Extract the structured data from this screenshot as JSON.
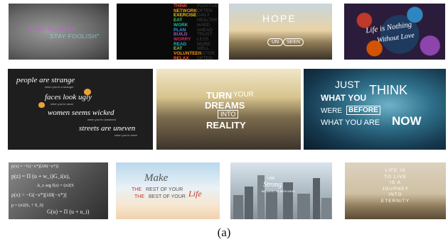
{
  "caption": "(a)",
  "tiles": {
    "t1": {
      "line1": "\"STAY HUNGRY",
      "line2": "STAY FOOLISH\""
    },
    "t2": {
      "left_words": [
        "THINK",
        "NETWORK",
        "EXERCISE",
        "EAT",
        "WORK",
        "PLAN",
        "BUILD",
        "WORRY",
        "READ",
        "EAT",
        "VOLUNTEER",
        "RELAX",
        "LOVE",
        "LIVE"
      ],
      "right_words": [
        "POSITIVELY",
        "OFTEN",
        "DAILY",
        "HEALTHY",
        "HARD",
        "AHEAD",
        "TRUST",
        "LESS",
        "MORE",
        "WELL",
        "FASTER",
        "OFTEN",
        "ALWAYS",
        "NOW"
      ]
    },
    "t3": {
      "line1": "HOPE",
      "line2": "UN",
      "line3": "SEEN"
    },
    "t4": {
      "line1": "Life is Nothing",
      "line2": "Without Love"
    },
    "t5": {
      "l1": "people are strange",
      "s1": "when you're a stranger",
      "l2": "faces look ugly",
      "s2": "when you're alone",
      "l3": "women seems wicked",
      "s3": "when you're unwanted",
      "l4": "streets are uneven",
      "s4": "when you're down"
    },
    "t6": {
      "w1": "TURN",
      "w2": "YOUR",
      "w3": "DREAMS",
      "w4": "INTO",
      "w5": "REALITY"
    },
    "t7": {
      "w1": "JUST",
      "w2": "WHAT YOU",
      "w3": "THINK",
      "w4": "WERE",
      "w5": "BEFORE",
      "w6": "WHAT YOU ARE",
      "w7": "NOW"
    },
    "t8": {
      "eq1": "p(x) = −G(−x*)[λH(−x*)]",
      "eq2": "p(z) = Π (u + w_i)G_i(u),",
      "eq3": "Δ_z arg f(z) = (σ2(S",
      "eq4": "p(x) = −G(−x*)[λH(−x*)]",
      "eq5": "p = (σ2(S, + S_0)",
      "eq6": "G(u) = Π (u + u_i)"
    },
    "t9": {
      "w1": "Make",
      "w2": "THE",
      "w3": "REST OF YOUR",
      "w4": "THE",
      "w5": "BEST OF YOUR",
      "w6": "Life"
    },
    "t10": {
      "w1": "I AM",
      "w2": "Strong",
      "w3": "BECAUSE I'VE BEEN WEAK"
    },
    "t11": {
      "lines": [
        "LIFE IS",
        "TO LIVE",
        "IS A",
        "JOURNEY",
        "INTO",
        "ETERNITY"
      ]
    }
  },
  "colors": {
    "t2_palette": [
      "#e74c3c",
      "#f39c12",
      "#f1c40f",
      "#2ecc71",
      "#1abc9c",
      "#3498db",
      "#9b59b6",
      "#e91e63",
      "#00bcd4",
      "#8bc34a",
      "#ff9800",
      "#ff5722",
      "#cddc39",
      "#03a9f4"
    ]
  }
}
